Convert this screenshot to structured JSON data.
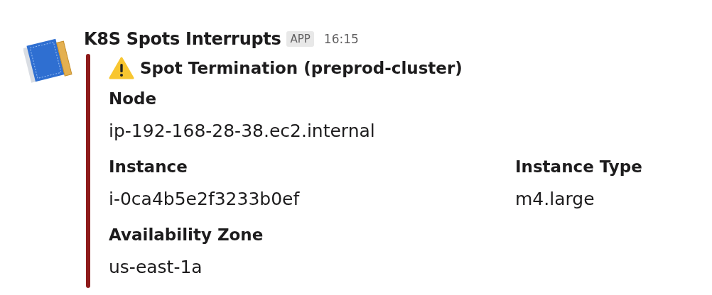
{
  "message": {
    "sender": "K8S Spots Interrupts",
    "badge": "APP",
    "time": "16:15",
    "attachment": {
      "color": "#8e1b1b",
      "title": "Spot Termination (preprod-cluster)",
      "fields": [
        {
          "title": "Node",
          "value": "ip-192-168-28-38.ec2.internal",
          "short": false
        },
        {
          "title": "Instance",
          "value": "i-0ca4b5e2f3233b0ef",
          "short": true
        },
        {
          "title": "Instance Type",
          "value": "m4.large",
          "short": true
        },
        {
          "title": "Availability Zone",
          "value": "us-east-1a",
          "short": false
        }
      ]
    }
  }
}
